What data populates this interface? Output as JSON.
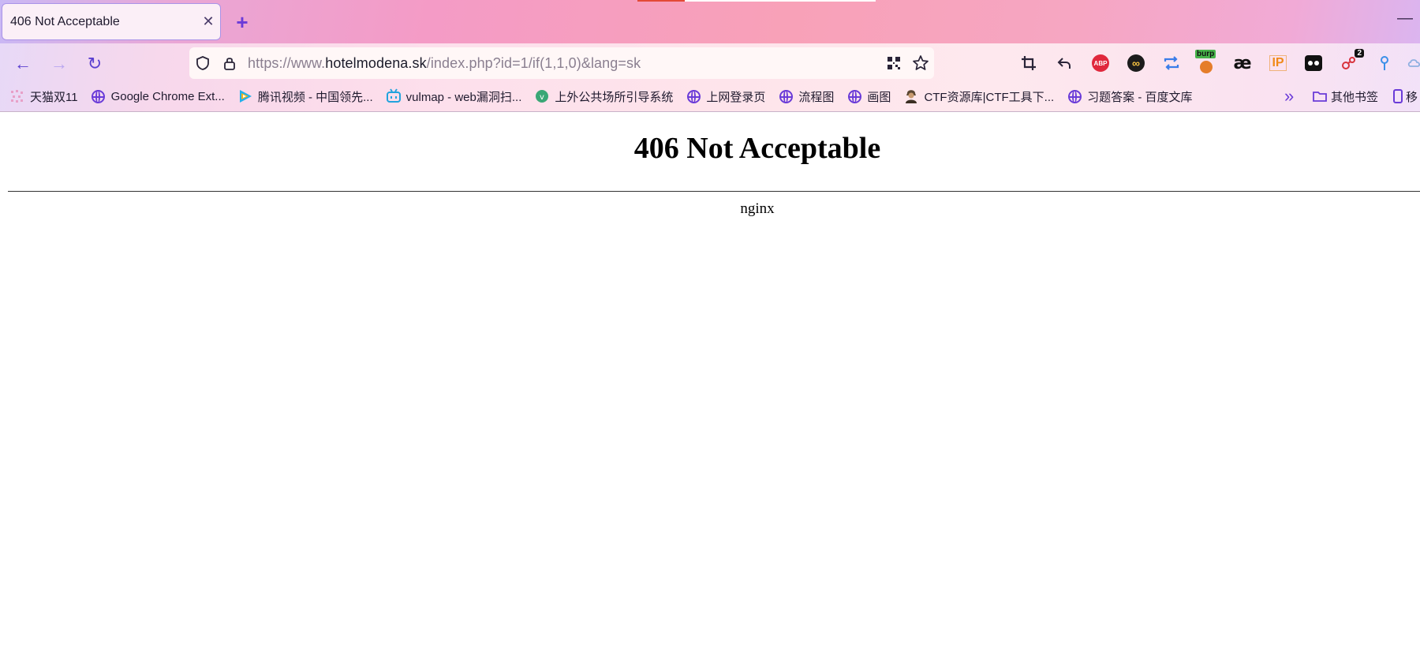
{
  "browser": {
    "tab": {
      "title": "406 Not Acceptable",
      "close_glyph": "✕"
    },
    "new_tab_glyph": "+",
    "minimize_glyph": "—",
    "nav": {
      "back_glyph": "←",
      "forward_glyph": "→",
      "reload_glyph": "↻"
    },
    "url": {
      "scheme": "https://www.",
      "host": "hotelmodena.sk",
      "path": "/index.php?id=1/if(1,1,0)&lang=sk"
    },
    "extensions": {
      "abp_label": "ABP",
      "burp_label": "burp",
      "ae_label": "æ",
      "ip_label": "IP",
      "badge_count": "2"
    },
    "bookmarks": [
      {
        "label": "天猫双11",
        "icon": "tmall-icon"
      },
      {
        "label": "Google Chrome Ext...",
        "icon": "globe-icon"
      },
      {
        "label": "腾讯视频 - 中国领先...",
        "icon": "tencent-video-icon"
      },
      {
        "label": "vulmap - web漏洞扫...",
        "icon": "bilibili-icon"
      },
      {
        "label": "上外公共场所引导系统",
        "icon": "vue-icon"
      },
      {
        "label": "上网登录页",
        "icon": "globe-icon"
      },
      {
        "label": "流程图",
        "icon": "globe-icon"
      },
      {
        "label": "画图",
        "icon": "globe-icon"
      },
      {
        "label": "CTF资源库|CTF工具下...",
        "icon": "hacker-icon"
      },
      {
        "label": "习题答案 - 百度文库",
        "icon": "globe-icon"
      }
    ],
    "bookmarks_overflow_glyph": "»",
    "other_bookmarks": "其他书签",
    "mobile_bookmarks": "移"
  },
  "page": {
    "heading": "406 Not Acceptable",
    "server": "nginx"
  },
  "colors": {
    "accent": "#6a3bd8",
    "tab_border": "#a993e8",
    "abp_red": "#e0283c"
  }
}
